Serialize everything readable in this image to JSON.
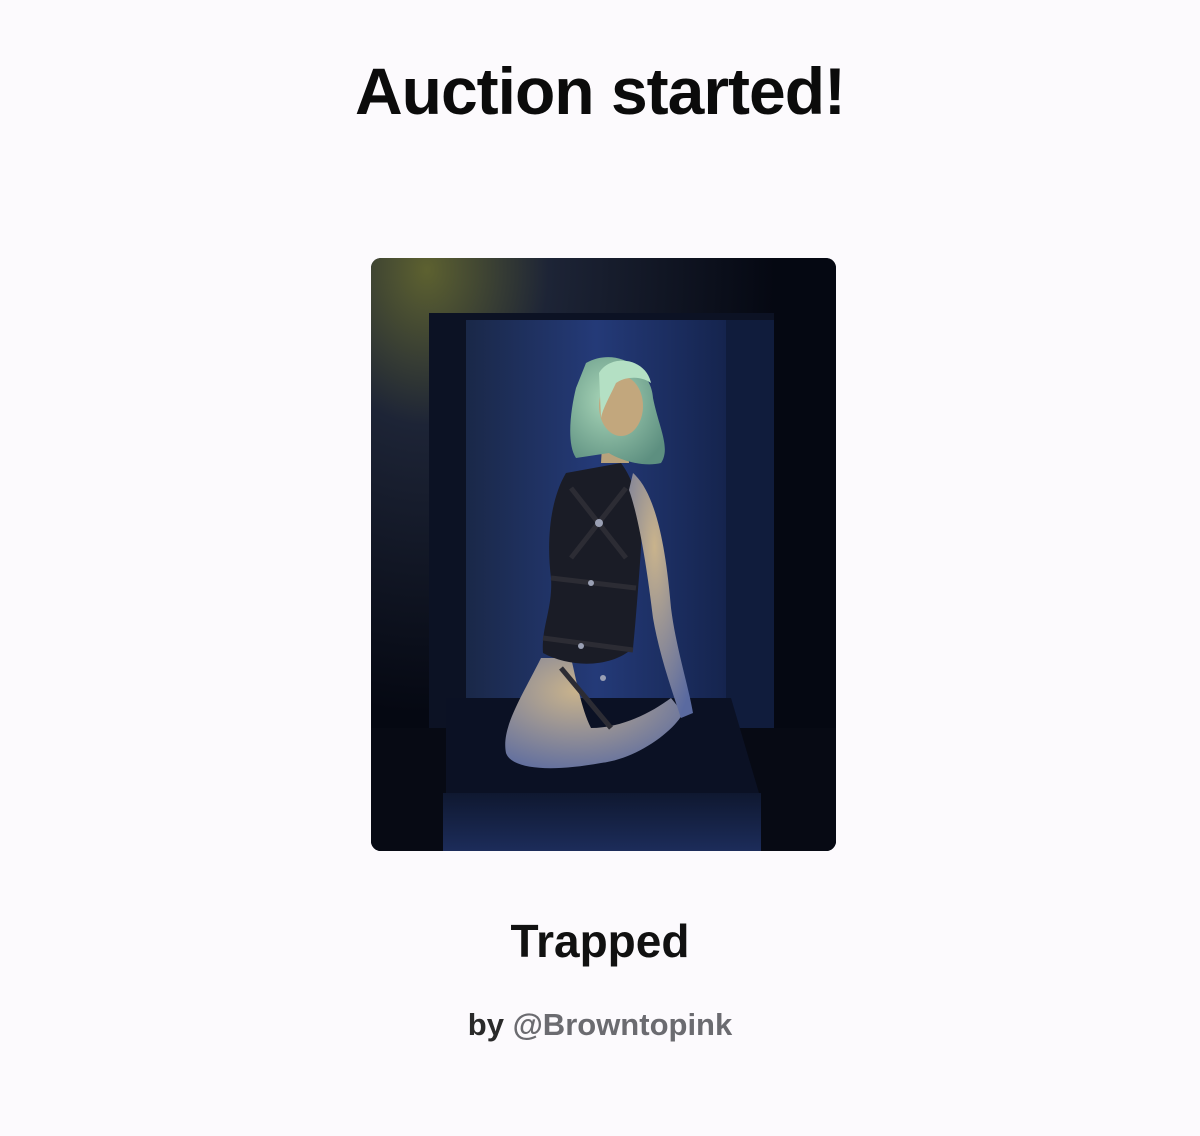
{
  "header": {
    "title": "Auction started!"
  },
  "artwork": {
    "title": "Trapped",
    "by_prefix": "by",
    "artist_handle": "@Browntopink"
  },
  "colors": {
    "background": "#fcfafd",
    "title_text": "#0b0b0b",
    "handle_text": "#6b6b70"
  }
}
